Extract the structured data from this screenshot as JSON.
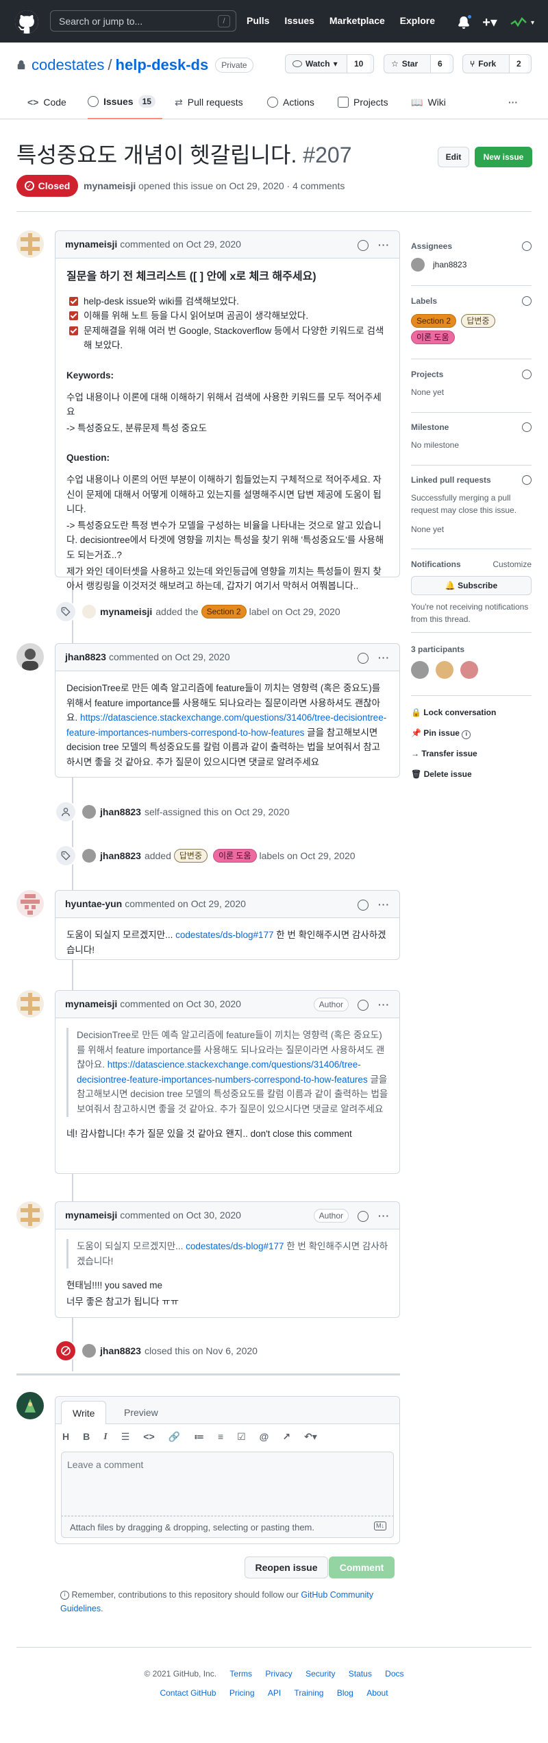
{
  "header": {
    "search_placeholder": "Search or jump to...",
    "slash_key": "/",
    "nav": [
      "Pulls",
      "Issues",
      "Marketplace",
      "Explore"
    ]
  },
  "repo": {
    "owner": "codestates",
    "separator": "/",
    "name": "help-desk-ds",
    "visibility": "Private",
    "watch_label": "Watch",
    "watch_count": "10",
    "star_label": "Star",
    "star_count": "6",
    "fork_label": "Fork",
    "fork_count": "2"
  },
  "tabs": [
    {
      "label": "Code"
    },
    {
      "label": "Issues",
      "count": "15"
    },
    {
      "label": "Pull requests"
    },
    {
      "label": "Actions"
    },
    {
      "label": "Projects"
    },
    {
      "label": "Wiki"
    }
  ],
  "tabs_more": "···",
  "issue": {
    "title": "특성중요도 개념이 헷갈립니다.",
    "number": "#207",
    "edit_label": "Edit",
    "new_label": "New issue",
    "state": "Closed",
    "author": "mynameisji",
    "meta_text": "opened this issue on Oct 29, 2020 · 4 comments"
  },
  "comments": {
    "first": {
      "author": "mynameisji",
      "time": "commented on Oct 29, 2020",
      "heading": "질문을 하기 전 체크리스트 ([ ] 안에 x로 체크 해주세요)",
      "checklist": [
        "help-desk issue와 wiki를 검색해보았다.",
        "이해를 위해 노트 등을 다시 읽어보며 곰곰이 생각해보았다.",
        "문제해결을 위해 여러 번 Google, Stackoverflow 등에서 다양한 키워드로 검색해 보았다."
      ],
      "keywords_title": "Keywords:",
      "keywords_line1": "수업 내용이나 이론에 대해 이해하기 위해서 검색에 사용한 키워드를 모두 적어주세요",
      "keywords_line2": "-> 특성중요도, 분류문제 특성 중요도",
      "question_title": "Question:",
      "question_text": "수업 내용이나 이론의 어떤 부분이 이해하기 힘들었는지 구체적으로 적어주세요. 자신이 문제에 대해서 어떻게 이해하고 있는지를 설명해주시면 답변 제공에 도움이 됩니다.",
      "question_l2": "-> 특성중요도란 특정 변수가 모델을 구성하는 비율을 나타내는 것으로 알고 있습니다. decisiontree에서 타겟에 영향을 끼치는 특성을 찾기 위해 '특성중요도'를 사용해도 되는거죠..?",
      "question_l3": "제가 와인 데이터셋을 사용하고 있는데 와인등급에 영향을 끼치는 특성들이 뭔지 찾아서 랭킹링을 이것저것 해보려고 하는데, 갑자기 여기서 막혀서 여쭤봅니다.."
    },
    "second": {
      "author": "jhan8823",
      "time": "commented on Oct 29, 2020",
      "text1": "DecisionTree로 만든 예측 알고리즘에 feature들이 끼치는 영향력 (혹은 중요도)를 위해서 feature importance를 사용해도 되나요라는 질문이라면 사용하셔도 괜찮아요.",
      "link": "https://datascience.stackexchange.com/questions/31406/tree-decisiontree-feature-importances-numbers-correspond-to-how-features",
      "text2": "글을 참고해보시면 decision tree 모델의 특성중요도를 칼럼 이름과 같이 출력하는 법을 보여줘서 참고하시면 좋을 것 같아요. 추가 질문이 있으시다면 댓글로 알려주세요"
    },
    "third": {
      "author": "hyuntae-yun",
      "time": "commented on Oct 29, 2020",
      "text1": "도움이 되실지 모르겠지만...",
      "link": "codestates/ds-blog#177",
      "text2": "한 번 확인해주시면 감사하겠습니다!"
    },
    "fourth": {
      "author": "mynameisji",
      "time": "commented on Oct 30, 2020",
      "badge": "Author",
      "quote1": "DecisionTree로 만든 예측 알고리즘에 feature들이 끼치는 영향력 (혹은 중요도)를 위해서 feature importance를 사용해도 되나요라는 질문이라면 사용하셔도 괜찮아요.",
      "quote_link": "https://datascience.stackexchange.com/questions/31406/tree-decisiontree-feature-importances-numbers-correspond-to-how-features",
      "quote2": "글을 참고해보시면 decision tree 모델의 특성중요도를 칼럼 이름과 같이 출력하는 법을 보여줘서 참고하시면 좋을 것 같아요. 추가 질문이 있으시다면 댓글로 알려주세요",
      "reply": "네! 감사합니다! 추가 질문 있을 것 같아요 왠지.. don't close this comment"
    },
    "fifth": {
      "author": "mynameisji",
      "time": "commented on Oct 30, 2020",
      "badge": "Author",
      "quote1": "도움이 되실지 모르겠지만...",
      "quote_link": "codestates/ds-blog#177",
      "quote2": "한 번 확인해주시면 감사하겠습니다!",
      "reply1": "현태님!!!! you saved me",
      "reply2": "너무 좋은 참고가 됩니다 ㅠㅠ"
    }
  },
  "events": {
    "label1": {
      "actor": "mynameisji",
      "pre": "added the",
      "label": "Section 2",
      "post": "label on Oct 29, 2020"
    },
    "assign": {
      "actor": "jhan8823",
      "text": "self-assigned this on Oct 29, 2020"
    },
    "label2": {
      "actor": "jhan8823",
      "pre": "added",
      "label_a": "답변중",
      "label_b": "이론 도움",
      "post": "labels on Oct 29, 2020"
    },
    "closed": {
      "actor": "jhan8823",
      "text": "closed this on Nov 6, 2020"
    }
  },
  "sidebar": {
    "assignees_title": "Assignees",
    "assignee": "jhan8823",
    "labels_title": "Labels",
    "labels": [
      "Section 2",
      "답변중",
      "이론 도움"
    ],
    "projects_title": "Projects",
    "projects_value": "None yet",
    "milestone_title": "Milestone",
    "milestone_value": "No milestone",
    "linked_title": "Linked pull requests",
    "linked_desc": "Successfully merging a pull request may close this issue.",
    "linked_value": "None yet",
    "notifications_title": "Notifications",
    "customize": "Customize",
    "subscribe": "Subscribe",
    "notif_desc": "You're not receiving notifications from this thread.",
    "participants": "3 participants",
    "lock": "Lock conversation",
    "pin": "Pin issue",
    "transfer": "Transfer issue",
    "delete": "Delete issue"
  },
  "composer": {
    "write_tab": "Write",
    "preview_tab": "Preview",
    "placeholder": "Leave a comment",
    "attach": "Attach files by dragging & dropping, selecting or pasting them.",
    "reopen": "Reopen issue",
    "comment": "Comment",
    "remember_pre": "Remember, contributions to this repository should follow our",
    "remember_link": "GitHub Community Guidelines",
    "remember_post": "."
  },
  "footer": {
    "copyright": "© 2021 GitHub, Inc.",
    "row1": [
      "Terms",
      "Privacy",
      "Security",
      "Status",
      "Docs"
    ],
    "row2": [
      "Contact GitHub",
      "Pricing",
      "API",
      "Training",
      "Blog",
      "About"
    ]
  }
}
